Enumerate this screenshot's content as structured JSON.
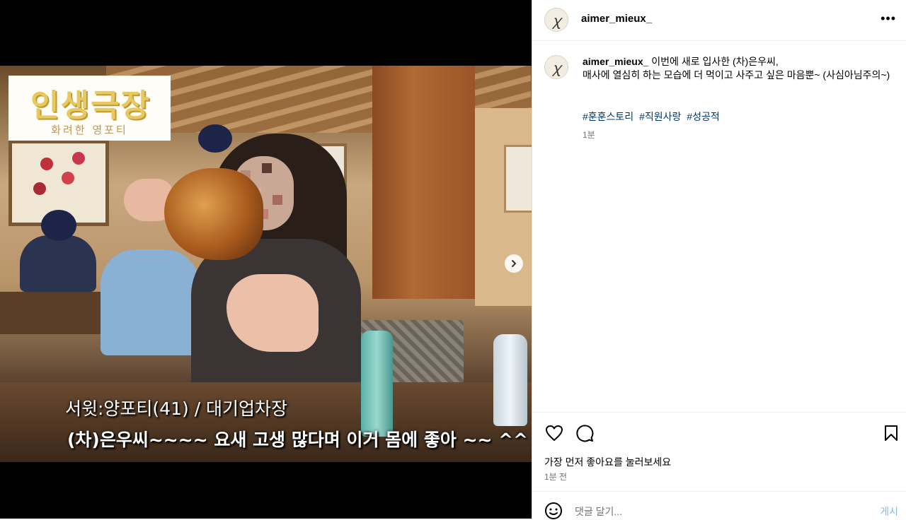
{
  "post": {
    "username": "aimer_mieux_",
    "avatar_glyph": "ꭓ",
    "caption_line1": "이번에 새로 입사한 (차)은우씨,",
    "caption_line2": "매사에 열심히 하는 모습에 더 먹이고 사주고 싶은 마음뿐~ (사심아님주의~)",
    "hashtags": [
      "#훈훈스토리",
      "#직원사랑",
      "#성공적"
    ],
    "caption_time": "1분",
    "likes_text": "가장 먼저 좋아요를 눌러보세요",
    "post_time": "1분 전",
    "comment_placeholder": "댓글 달기...",
    "post_button": "게시",
    "more_icon": "more-options-icon"
  },
  "image": {
    "logo_title": "인생극장",
    "logo_subtitle": "화려한 영포티",
    "caption1": "서윗:양포티(41) / 대기업차장",
    "caption2": "(차)은우씨~~~~ 요새 고생 많다며 이거 몸에 좋아 ~~ ^^"
  },
  "colors": {
    "link": "#00376b",
    "post_button": "#8ab8f0",
    "secondary_text": "#737373",
    "logo_gold": "#e8c860"
  }
}
